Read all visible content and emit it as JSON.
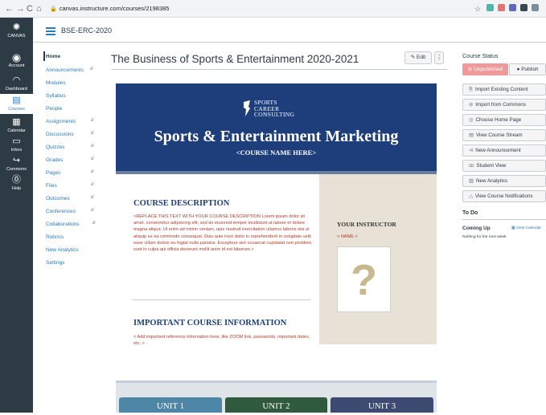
{
  "browser": {
    "url": "canvas.instructure.com/courses/2198385"
  },
  "global_nav": {
    "logo_label": "CANVAS",
    "items": [
      {
        "label": "Account",
        "icon": "user-icon"
      },
      {
        "label": "Dashboard",
        "icon": "dashboard-icon"
      },
      {
        "label": "Courses",
        "icon": "book-icon"
      },
      {
        "label": "Calendar",
        "icon": "calendar-icon"
      },
      {
        "label": "Inbox",
        "icon": "inbox-icon"
      },
      {
        "label": "Commons",
        "icon": "commons-icon"
      },
      {
        "label": "Help",
        "icon": "help-icon"
      }
    ]
  },
  "header": {
    "breadcrumb": "BSE-ERC-2020"
  },
  "course_nav": {
    "items": [
      {
        "label": "Home"
      },
      {
        "label": "Announcements"
      },
      {
        "label": "Modules"
      },
      {
        "label": "Syllabus"
      },
      {
        "label": "People"
      },
      {
        "label": "Assignments"
      },
      {
        "label": "Discussions"
      },
      {
        "label": "Quizzes"
      },
      {
        "label": "Grades"
      },
      {
        "label": "Pages"
      },
      {
        "label": "Files"
      },
      {
        "label": "Outcomes"
      },
      {
        "label": "Conferences"
      },
      {
        "label": "Collaborations"
      },
      {
        "label": "Rubrics"
      },
      {
        "label": "New Analytics"
      },
      {
        "label": "Settings"
      }
    ]
  },
  "main": {
    "title": "The Business of Sports & Entertainment 2020-2021",
    "edit_label": "Edit",
    "more_label": "⋮",
    "banner": {
      "logo_line1": "SPORTS",
      "logo_line2": "CAREER",
      "logo_line3": "CONSULTING",
      "title": "Sports & Entertainment Marketing",
      "subtitle": "<COURSE NAME HERE>"
    },
    "description": {
      "heading": "COURSE DESCRIPTION",
      "body": "<REPLACE THIS TEXT WITH YOUR COURSE DESCRIPTION Lorem ipsum dolor sit amet, consectetur adipiscing elit, sed do eiusmod tempor incididunt ut labore et dolore magna aliqua. Ut enim ad minim veniam, quis nostrud exercitation ullamco laboris nisi ut aliquip ex ea commodo consequat. Duis aute irure dolor in reprehenderit in voluptate velit esse cillum dolore eu fugiat nulla pariatur. Excepteur sint occaecat cupidatat non proident, sunt in culpa qui officia deserunt mollit anim id est laborum.>"
    },
    "important": {
      "heading": "IMPORTANT COURSE INFORMATION",
      "body": "< Add important reference information here, like ZOOM link, passwords, important dates, etc. >"
    },
    "instructor": {
      "title": "YOUR INSTRUCTOR",
      "name": "< NAME >",
      "photo_glyph": "?"
    },
    "units": [
      {
        "label": "UNIT 1",
        "color": "#4e86a8"
      },
      {
        "label": "UNIT 2",
        "color": "#2f5a3e"
      },
      {
        "label": "UNIT 3",
        "color": "#3d4a72"
      }
    ]
  },
  "sidebar": {
    "status_title": "Course Status",
    "unpublished_label": "Unpublished",
    "publish_label": "Publish",
    "buttons": [
      {
        "label": "Import Existing Content",
        "icon": "import-icon"
      },
      {
        "label": "Import from Commons",
        "icon": "commons-icon"
      },
      {
        "label": "Choose Home Page",
        "icon": "home-page-icon"
      },
      {
        "label": "View Course Stream",
        "icon": "stream-icon"
      },
      {
        "label": "New Announcement",
        "icon": "announcement-icon"
      },
      {
        "label": "Student View",
        "icon": "student-view-icon"
      },
      {
        "label": "New Analytics",
        "icon": "analytics-icon"
      },
      {
        "label": "View Course Notifications",
        "icon": "bell-icon"
      }
    ],
    "todo_title": "To Do",
    "coming_up": "Coming Up",
    "view_calendar": "View Calendar",
    "nothing_text": "Nothing for the next week"
  }
}
